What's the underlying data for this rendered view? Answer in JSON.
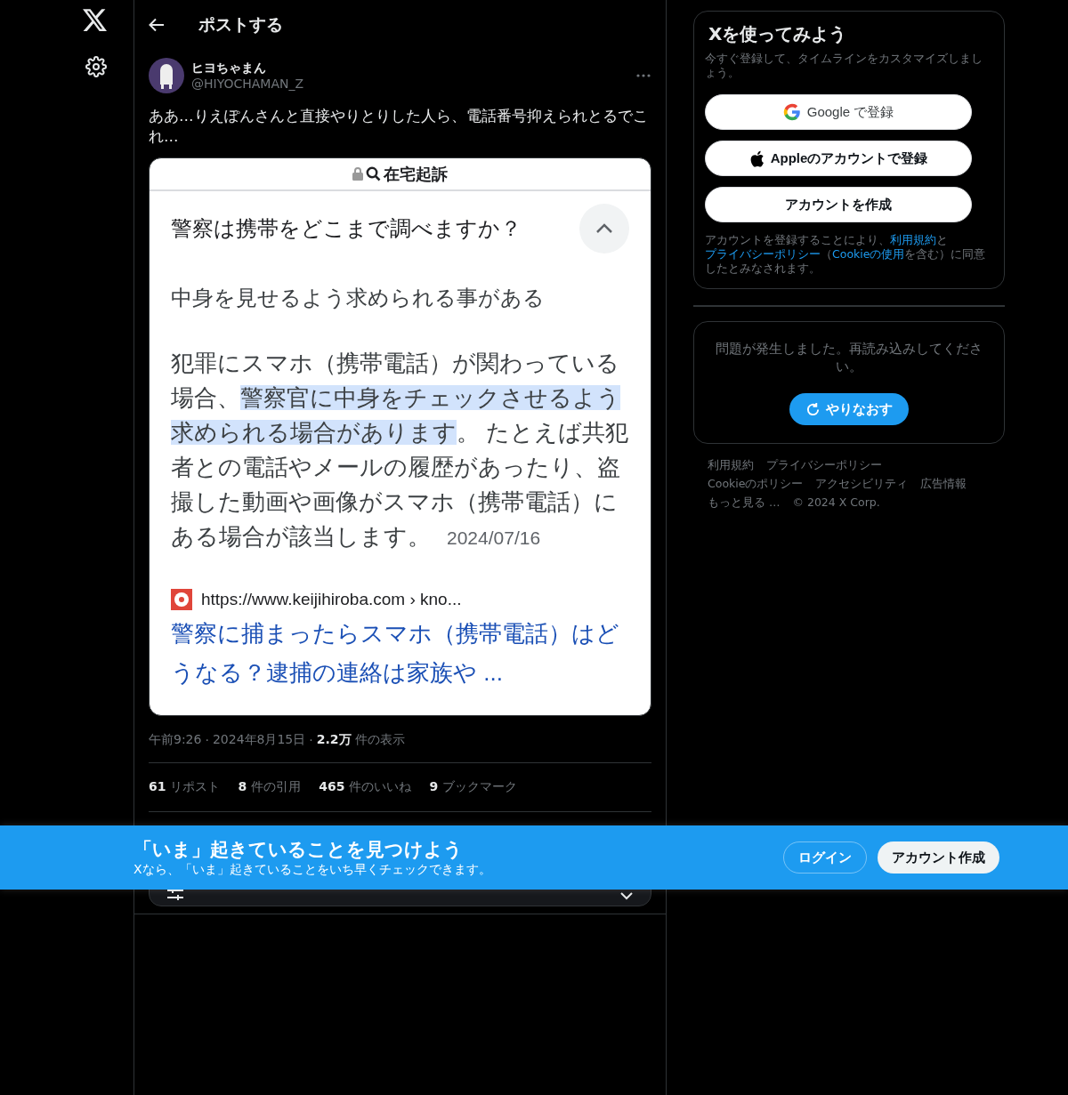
{
  "header": {
    "title": "ポストする"
  },
  "post": {
    "author": {
      "name": "ヒヨちゃまん",
      "handle": "@HIYOCHAMAN_Z"
    },
    "text": "ああ…りえぽんさんと直接やりとりした人ら、電話番号抑えられとるでこれ…",
    "screenshot": {
      "search_query": "在宅起訴",
      "question": "警察は携帯をどこまで調べますか？",
      "expanded": true,
      "answer": "中身を見せるよう求められる事がある",
      "paragraph": [
        {
          "text": "犯罪にスマホ（携帯電話）が関わっている場合、",
          "highlighted": false
        },
        {
          "text": "警察官に中身をチェックさせるよう求められる場合があります",
          "highlighted": true
        },
        {
          "text": "。 たとえば共犯者との電話やメールの履歴があったり、盗撮した動画や画像がスマホ（携帯電話）にある場合が該当します。",
          "highlighted": false
        }
      ],
      "date": "2024/07/16",
      "url": "https://www.keijihiroba.com › kno...",
      "link_title": "警察に捕まったらスマホ（携帯電話）はどうなる？逮捕の連絡は家族や ..."
    },
    "meta": {
      "separator": "·",
      "time": "午前9:26",
      "date": "2024年8月15日",
      "views": "2.2万",
      "views_label": "件の表示"
    },
    "stats": [
      {
        "count": "61",
        "label": "リポスト"
      },
      {
        "count": "8",
        "label": "件の引用"
      },
      {
        "count": "465",
        "label": "件のいいね"
      },
      {
        "count": "9",
        "label": "ブックマーク"
      }
    ]
  },
  "signup": {
    "title": "Xを使ってみよう",
    "subtitle": "今すぐ登録して、タイムラインをカスタマイズしましょう。",
    "buttons": [
      {
        "kind": "google",
        "label": "Google で登録"
      },
      {
        "kind": "apple",
        "label": "Appleのアカウントで登録"
      },
      {
        "kind": "plain",
        "label": "アカウントを作成"
      }
    ],
    "terms": [
      {
        "kind": "text",
        "text": "アカウントを登録することにより、"
      },
      {
        "kind": "link",
        "text": "利用規約"
      },
      {
        "kind": "text",
        "text": "と"
      },
      {
        "kind": "link",
        "text": "プライバシーポリシー"
      },
      {
        "kind": "text",
        "text": "（"
      },
      {
        "kind": "link",
        "text": "Cookieの使用"
      },
      {
        "kind": "text",
        "text": "を含む）に同意したとみなされます。"
      }
    ]
  },
  "error": {
    "message": "問題が発生しました。再読み込みしてください。",
    "retry": "やりなおす"
  },
  "footer_links": [
    "利用規約",
    "プライバシーポリシー",
    "Cookieのポリシー",
    "アクセシビリティ",
    "広告情報",
    "もっと見る …",
    "© 2024 X Corp."
  ],
  "banner": {
    "title": "「いま」起きていることを見つけよう",
    "subtitle": "Xなら、「いま」起きていることをいち早くチェックできます。",
    "login": "ログイン",
    "signup": "アカウント作成"
  }
}
